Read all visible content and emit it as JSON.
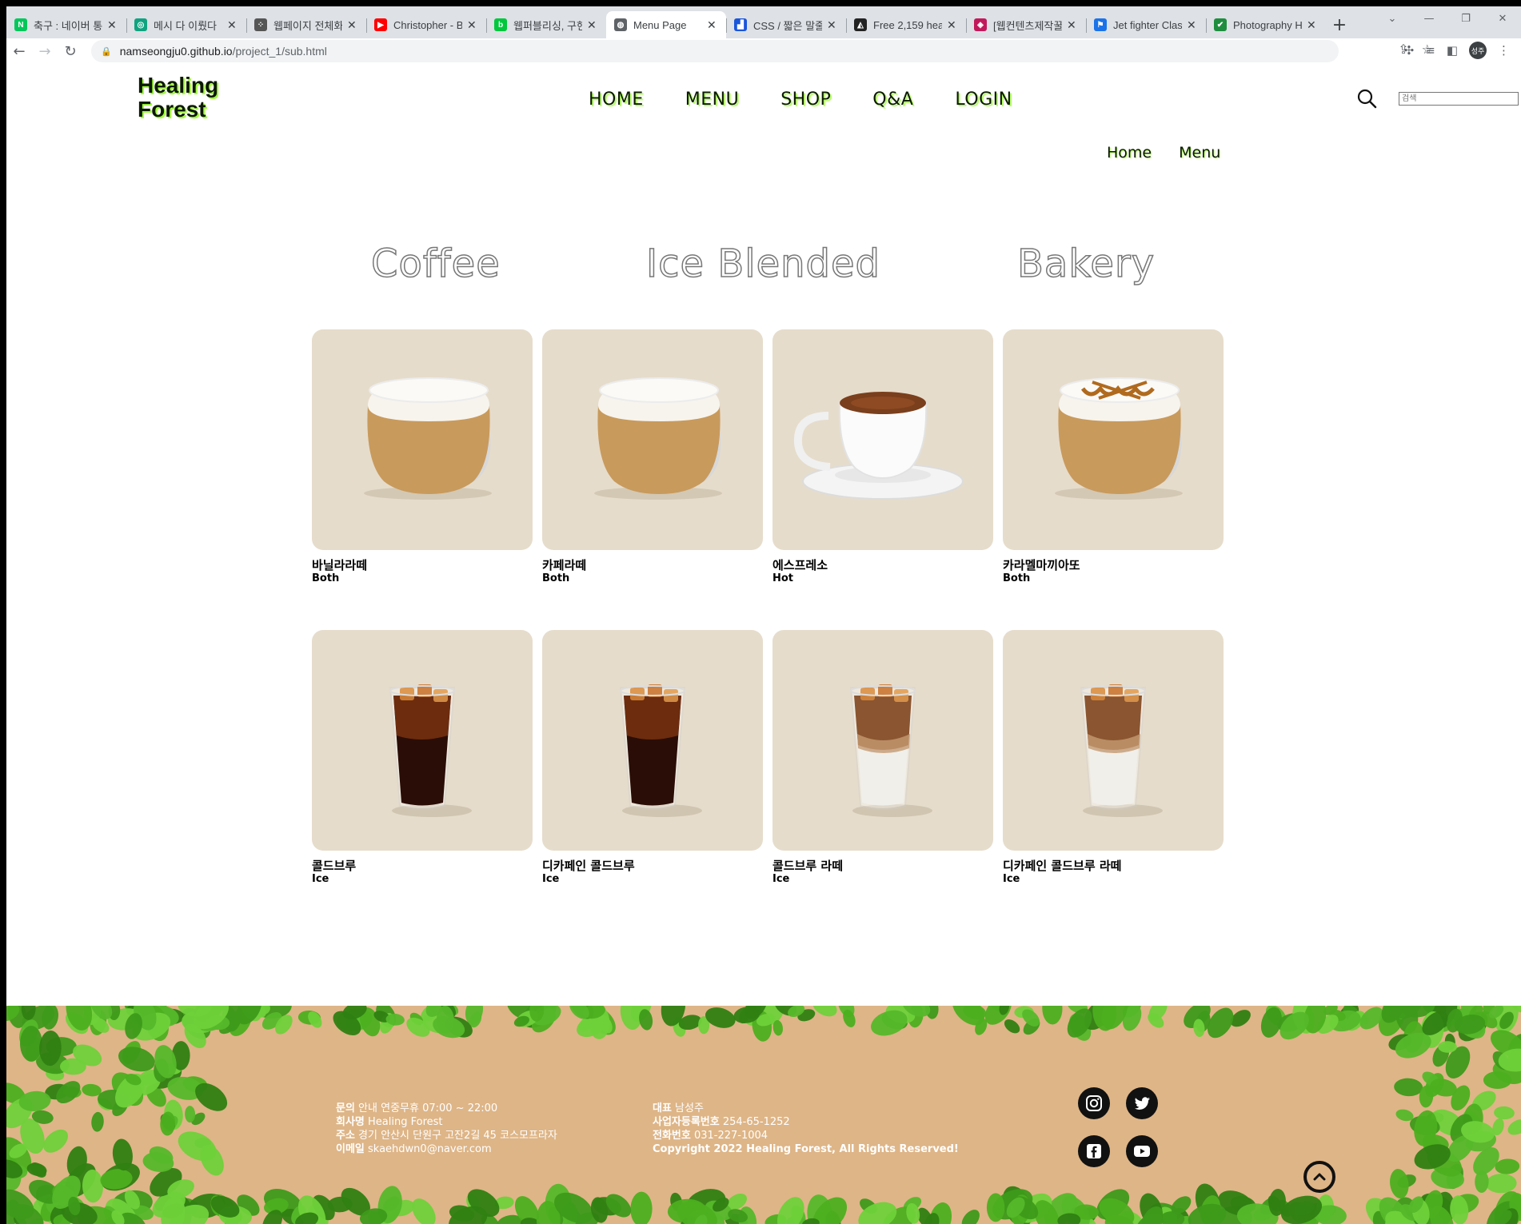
{
  "browser": {
    "tabs": [
      {
        "title": "축구 : 네이버 통",
        "color": "#03c75a",
        "glyph": "N"
      },
      {
        "title": "메시 다 이뤘다",
        "color": "#10a37f",
        "glyph": "◎"
      },
      {
        "title": "웹페이지 전체화",
        "color": "#555555",
        "glyph": "⁘"
      },
      {
        "title": "Christopher - B",
        "color": "#ff0000",
        "glyph": "▶"
      },
      {
        "title": "웹퍼블리싱, 구현",
        "color": "#00c73c",
        "glyph": "b"
      },
      {
        "title": "Menu Page",
        "color": "#5f6368",
        "glyph": "◍",
        "active": true
      },
      {
        "title": "CSS / 짧은 말줄",
        "color": "#1a56db",
        "glyph": "▟"
      },
      {
        "title": "Free 2,159 hear",
        "color": "#222222",
        "glyph": "◭"
      },
      {
        "title": "[웹컨텐츠제작꿀",
        "color": "#c2185b",
        "glyph": "◈"
      },
      {
        "title": "Jet fighter Class",
        "color": "#1a73e8",
        "glyph": "⚑"
      },
      {
        "title": "Photography H",
        "color": "#1e8e3e",
        "glyph": "✔"
      }
    ],
    "url_host": "namseongju0.github.io",
    "url_path": "/project_1/sub.html",
    "profile_initials": "성주"
  },
  "header": {
    "logo_line1": "Healing",
    "logo_line2": "Forest",
    "nav": [
      "HOME",
      "MENU",
      "SHOP",
      "Q&A",
      "LOGIN"
    ],
    "search_placeholder": "검색"
  },
  "breadcrumb": [
    "Home",
    "Menu"
  ],
  "categories": [
    "Coffee",
    "Ice Blended",
    "Bakery"
  ],
  "menu_items": [
    {
      "name": "바닐라라떼",
      "type": "Both",
      "drink": "latte"
    },
    {
      "name": "카페라떼",
      "type": "Both",
      "drink": "latte"
    },
    {
      "name": "에스프레소",
      "type": "Hot",
      "drink": "espresso"
    },
    {
      "name": "카라멜마끼아또",
      "type": "Both",
      "drink": "caramel"
    },
    {
      "name": "콜드브루",
      "type": "Ice",
      "drink": "coldbrew"
    },
    {
      "name": "디카페인 콜드브루",
      "type": "Ice",
      "drink": "coldbrew"
    },
    {
      "name": "콜드브루 라떼",
      "type": "Ice",
      "drink": "coldbrewlatte"
    },
    {
      "name": "디카페인 콜드브루 라떼",
      "type": "Ice",
      "drink": "coldbrewlatte"
    }
  ],
  "footer": {
    "col1": [
      {
        "label": "문의",
        "text": " 안내 연중무휴 07:00 ~ 22:00"
      },
      {
        "label": "회사명",
        "text": " Healing Forest"
      },
      {
        "label": "주소",
        "text": " 경기 안산시 단원구 고잔2길 45 코스모프라자"
      },
      {
        "label": "이메일",
        "text": " skaehdwn0@naver.com"
      }
    ],
    "col2": [
      {
        "label": "대표",
        "text": " 남성주"
      },
      {
        "label": "사업자등록번호",
        "text": " 254-65-1252"
      },
      {
        "label": "전화번호",
        "text": " 031-227-1004"
      },
      {
        "label": "",
        "text": "Copyright 2022 Healing Forest, All Rights Reserved!"
      }
    ],
    "sns": [
      "instagram-icon",
      "twitter-icon",
      "facebook-icon",
      "youtube-icon"
    ]
  },
  "colors": {
    "card_bg": "#e6dccb",
    "footer_bg": "#deb587",
    "accent_glow": "#9eff3b",
    "leaf_green": "#4caf1f"
  }
}
